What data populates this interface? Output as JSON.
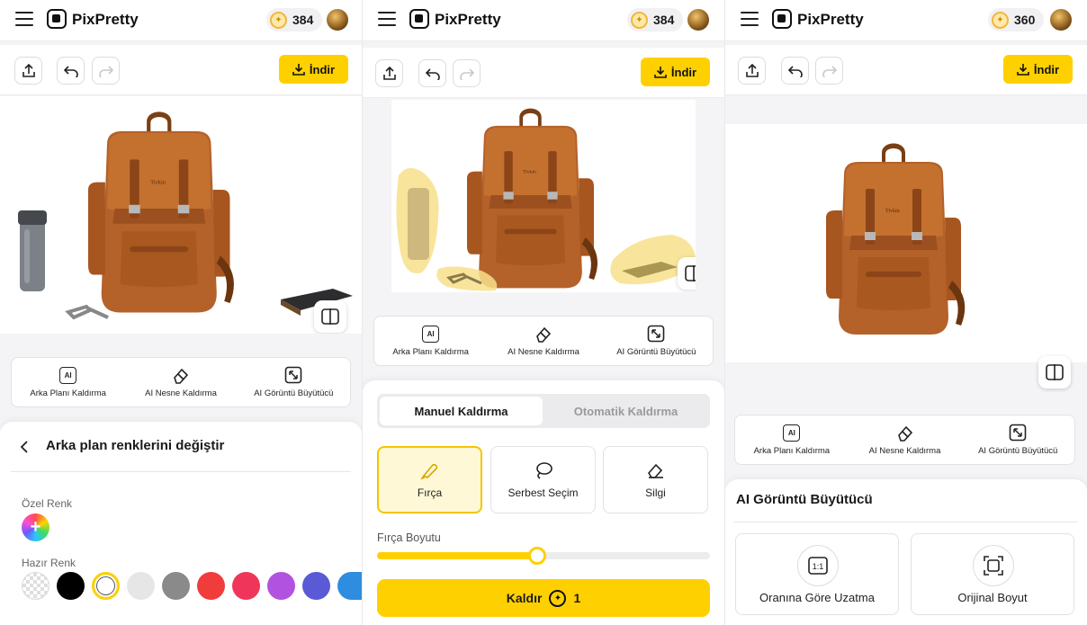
{
  "app": {
    "brand": "PixPretty",
    "download_label": "İndir"
  },
  "panel1": {
    "credits": "384",
    "features": [
      {
        "label": "Arka Planı Kaldırma",
        "icon": "ai-icon"
      },
      {
        "label": "AI Nesne Kaldırma",
        "icon": "eraser-icon"
      },
      {
        "label": "AI Görüntü Büyütücü",
        "icon": "expand-icon"
      }
    ],
    "sheet": {
      "title": "Arka plan renklerini değiştir",
      "custom_color_label": "Özel Renk",
      "preset_color_label": "Hazır Renk",
      "swatches": [
        "transparent",
        "#000000",
        "#ffffff",
        "#e6e6e6",
        "#8a8a8a",
        "#f13c3c",
        "#f0355a",
        "#b252e0",
        "#5a5ad6",
        "#2f8de0"
      ],
      "selected_swatch": "#ffffff"
    }
  },
  "panel2": {
    "credits": "384",
    "features": [
      {
        "label": "Arka Planı Kaldırma",
        "icon": "ai-icon"
      },
      {
        "label": "AI Nesne Kaldırma",
        "icon": "eraser-icon"
      },
      {
        "label": "AI Görüntü Büyütücü",
        "icon": "expand-icon"
      }
    ],
    "tabs": {
      "active": "Manuel Kaldırma",
      "inactive": "Otomatik Kaldırma"
    },
    "modes": [
      {
        "label": "Fırça",
        "icon": "brush-icon",
        "selected": true
      },
      {
        "label": "Serbest Seçim",
        "icon": "lasso-icon",
        "selected": false
      },
      {
        "label": "Silgi",
        "icon": "eraser-icon",
        "selected": false
      }
    ],
    "brush_size_label": "Fırça Boyutu",
    "brush_size_fraction": 0.48,
    "remove_button": {
      "label": "Kaldır",
      "cost": "1"
    }
  },
  "panel3": {
    "credits": "360",
    "features": [
      {
        "label": "Arka Planı Kaldırma",
        "icon": "ai-icon"
      },
      {
        "label": "AI Nesne Kaldırma",
        "icon": "eraser-icon"
      },
      {
        "label": "AI Görüntü Büyütücü",
        "icon": "expand-icon"
      }
    ],
    "sheet": {
      "title": "AI Görüntü Büyütücü",
      "options": [
        {
          "label": "Oranına Göre Uzatma",
          "icon": "ratio-icon"
        },
        {
          "label": "Orijinal Boyut",
          "icon": "frame-icon"
        }
      ]
    }
  },
  "colors": {
    "accent": "#ffd000",
    "mask": "#f7e08a"
  }
}
